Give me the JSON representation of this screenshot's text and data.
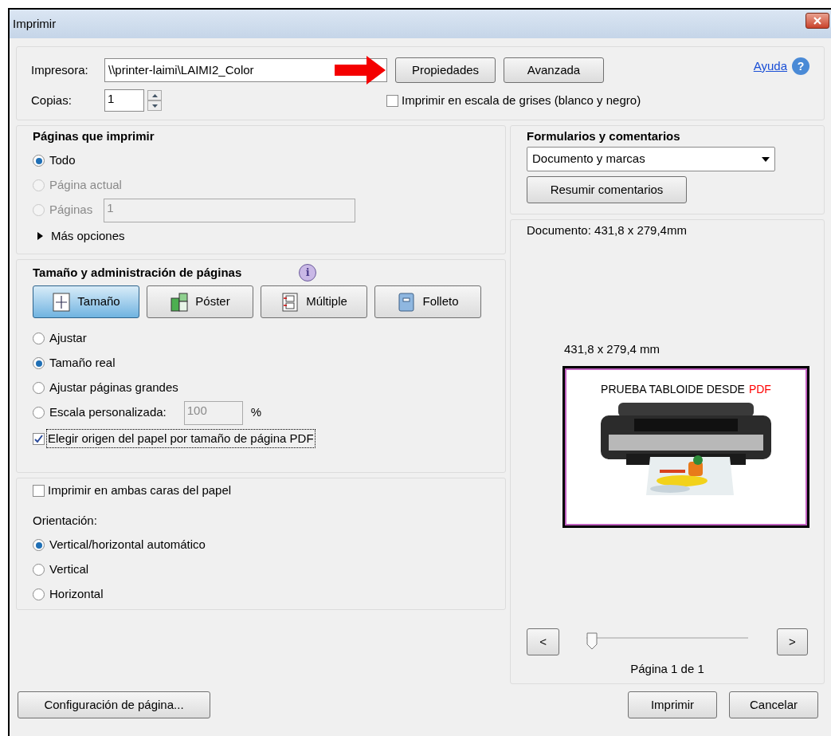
{
  "window": {
    "title": "Imprimir"
  },
  "printer": {
    "label": "Impresora:",
    "value": "\\\\printer-laimi\\LAIMI2_Color"
  },
  "top_buttons": [
    {
      "label": "Propiedades"
    },
    {
      "label": "Avanzada"
    }
  ],
  "help_link": "Ayuda",
  "help_icon": "?",
  "info_icon": "i",
  "copies": {
    "label": "Copias:",
    "value": "1"
  },
  "grayscale": {
    "label": "Imprimir en escala de grises (blanco y negro)",
    "checked": false
  },
  "pages_section": {
    "title": "Páginas que imprimir",
    "more": "Más opciones",
    "options": [
      {
        "label": "Todo",
        "selected": true,
        "disabled": false
      },
      {
        "label": "Página actual",
        "selected": false,
        "disabled": true
      },
      {
        "label": "Páginas",
        "selected": false,
        "disabled": true,
        "field": "1"
      }
    ]
  },
  "size_section": {
    "title": "Tamaño y administración de páginas",
    "modes": [
      {
        "label": "Tamaño",
        "kind": "size",
        "selected": true
      },
      {
        "label": "Póster",
        "kind": "poster",
        "selected": false
      },
      {
        "label": "Múltiple",
        "kind": "multiple",
        "selected": false
      },
      {
        "label": "Folleto",
        "kind": "booklet",
        "selected": false
      }
    ],
    "options": [
      {
        "label": "Ajustar",
        "selected": false
      },
      {
        "label": "Tamaño real",
        "selected": true
      },
      {
        "label": "Ajustar páginas grandes",
        "selected": false
      },
      {
        "label": "Escala personalizada:",
        "selected": false,
        "field": "100",
        "unit": "%"
      }
    ],
    "paper_source": {
      "label": "Elegir origen del papel por tamaño de página PDF",
      "checked": true
    }
  },
  "duplex": {
    "label": "Imprimir en ambas caras del papel",
    "checked": false
  },
  "orientation": {
    "title": "Orientación:",
    "options": [
      {
        "label": "Vertical/horizontal automático",
        "selected": true
      },
      {
        "label": "Vertical",
        "selected": false
      },
      {
        "label": "Horizontal",
        "selected": false
      }
    ]
  },
  "forms": {
    "title": "Formularios y comentarios",
    "value": "Documento y marcas",
    "button": "Resumir comentarios"
  },
  "preview": {
    "document": "Documento: 431,8 x 279,4mm",
    "size": "431,8 x 279,4 mm",
    "heading": "PRUEBA TABLOIDE DESDE",
    "heading_accent": "PDF",
    "prev": "<",
    "next": ">",
    "level": 0,
    "page": "Página 1 de 1"
  },
  "bottom": {
    "setup": "Configuración de página...",
    "print": "Imprimir",
    "cancel": "Cancelar"
  }
}
